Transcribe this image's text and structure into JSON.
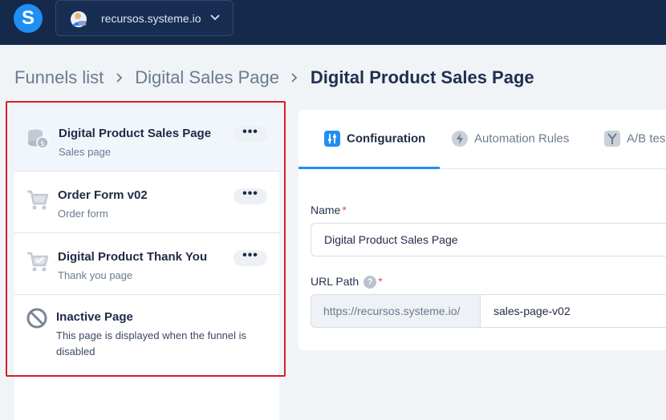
{
  "topbar": {
    "logo_letter": "S",
    "workspace": {
      "label": "recursos.systeme.io"
    }
  },
  "breadcrumb": {
    "items": [
      "Funnels list",
      "Digital Sales Page",
      "Digital Product Sales Page"
    ]
  },
  "steps": [
    {
      "title": "Digital Product Sales Page",
      "subtitle": "Sales page",
      "menu": "•••"
    },
    {
      "title": "Order Form v02",
      "subtitle": "Order form",
      "menu": "•••"
    },
    {
      "title": "Digital Product Thank You",
      "subtitle": "Thank you page",
      "menu": "•••"
    }
  ],
  "inactive": {
    "title": "Inactive Page",
    "description": "This page is displayed when the funnel is disabled"
  },
  "tabs": [
    {
      "label": "Configuration",
      "icon": "sliders-icon"
    },
    {
      "label": "Automation Rules",
      "icon": "bolt-icon"
    },
    {
      "label": "A/B tes",
      "icon": "split-icon"
    }
  ],
  "form": {
    "name_label": "Name",
    "name_value": "Digital Product Sales Page",
    "url_label": "URL Path",
    "help": "?",
    "required_mark": "*",
    "url_prefix": "https://recursos.systeme.io/",
    "url_value": "sales-page-v02"
  },
  "colors": {
    "topbar": "#15294b",
    "accent": "#1f8ff4",
    "highlight": "#d21f2a"
  }
}
